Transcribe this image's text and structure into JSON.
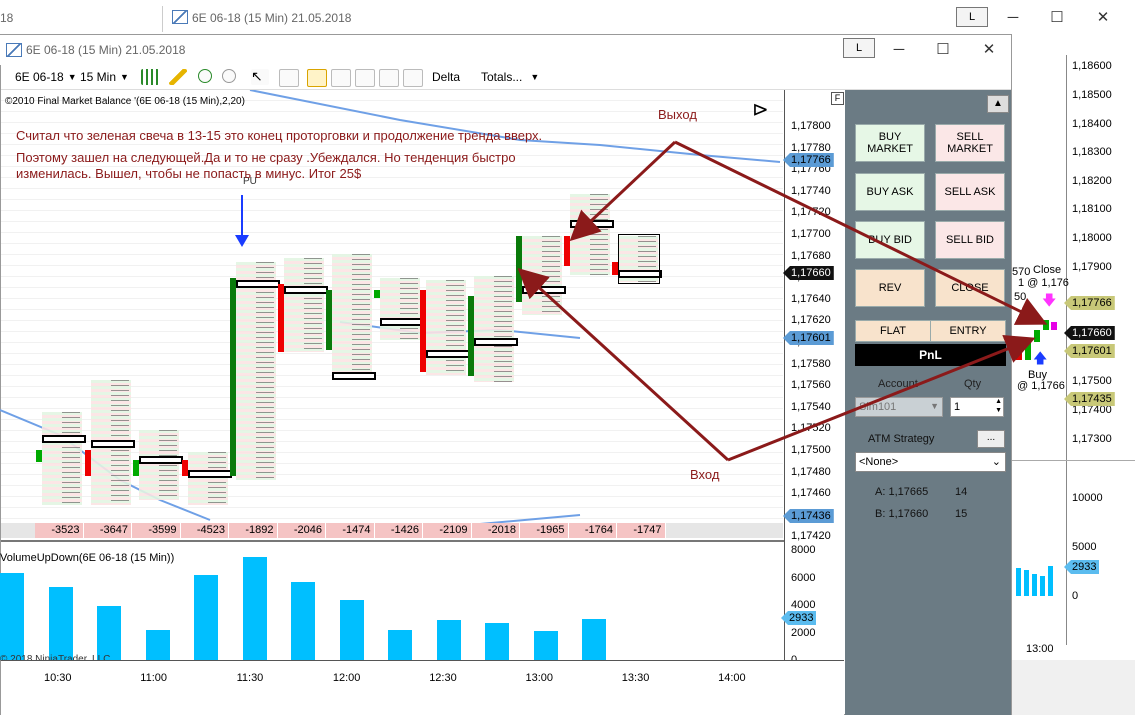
{
  "back_window": {
    "left_title_fragment": "18",
    "title": "6E 06-18 (15 Min)  21.05.2018",
    "l_button": "L",
    "minimize": "─",
    "maximize": "☐",
    "close": "✕",
    "price_axis": [
      "1,18600",
      "1,18500",
      "1,18400",
      "1,18300",
      "1,18200",
      "1,18100",
      "1,18000",
      "1,17900",
      "1,17500",
      "1,17400",
      "1,17300"
    ],
    "price_tags": [
      {
        "label": "1,17766",
        "color": "#c8c878"
      },
      {
        "label": "1,17660",
        "color": "#111111",
        "text_color": "#ffffff"
      },
      {
        "label": "1,17601",
        "color": "#c8c878"
      },
      {
        "label": "1,17435",
        "color": "#c8c878"
      }
    ],
    "volume_axis": [
      "10000",
      "5000",
      "0"
    ],
    "volume_tag": "2933",
    "time_label": "13:00",
    "chart_texts": {
      "a": "570",
      "b": "Close",
      "c": "1 @ 1,176",
      "d": "50",
      "e": "Buy",
      "f": "@ 1,1766"
    }
  },
  "front_window": {
    "title": "6E 06-18 (15 Min)  21.05.2018",
    "l_button": "L",
    "minimize": "─",
    "maximize": "☐",
    "close": "✕",
    "toolbar": {
      "instrument": "6E 06-18",
      "timeframe": "15 Min",
      "delta": "Delta",
      "totals": "Totals..."
    },
    "indicator_label": "©2010 Final Market Balance  '(6E 06-18 (15 Min),2,20)",
    "f_box": "F",
    "price_axis": [
      "1,17800",
      "1,17780",
      "1,17760",
      "1,17740",
      "1,17720",
      "1,17700",
      "1,17680",
      "1,17660",
      "1,17640",
      "1,17620",
      "1,17600",
      "1,17580",
      "1,17560",
      "1,17540",
      "1,17520",
      "1,17500",
      "1,17480",
      "1,17460",
      "1,17440",
      "1,17420"
    ],
    "price_tags": [
      {
        "label": "1,17766",
        "color": "#5b9bd5"
      },
      {
        "label": "1,17660",
        "color": "#111111",
        "text_color": "#ffffff"
      },
      {
        "label": "1,17601",
        "color": "#5b9bd5"
      },
      {
        "label": "1,17436",
        "color": "#5b9bd5"
      }
    ],
    "deltas": [
      "-3523",
      "-3647",
      "-3599",
      "-4523",
      "-1892",
      "-2046",
      "-1474",
      "-1426",
      "-2109",
      "-2018",
      "-1965",
      "-1764",
      "-1747"
    ],
    "poc_marker": "PU",
    "volume_indicator_label": "VolumeUpDown(6E 06-18 (15 Min))",
    "volume_axis": [
      "8000",
      "6000",
      "4000",
      "2000",
      "0"
    ],
    "volume_tag": "2933",
    "volume_values": [
      6300,
      5300,
      3900,
      2200,
      6200,
      7500,
      5700,
      4400,
      2200,
      2900,
      2700,
      2100,
      3000
    ],
    "copyright": "© 2018 NinjaTrader, LLC",
    "time_labels": [
      "10:30",
      "11:00",
      "11:30",
      "12:00",
      "12:30",
      "13:00",
      "13:30",
      "14:00"
    ]
  },
  "annotation": {
    "lines": [
      "Считал что зеленая свеча в 13-15 это конец проторговки и продолжение тренда вверх.",
      "Поэтому зашел на следующей.Да и то не сразу .Убеждался. Но тенденция быстро",
      "изменилась. Вышел, чтобы не попасть в минус. Итог 25$"
    ],
    "exit_label": "Выход",
    "entry_label": "Вход"
  },
  "order_panel": {
    "buy_market": "BUY MARKET",
    "sell_market": "SELL MARKET",
    "buy_ask": "BUY ASK",
    "sell_ask": "SELL ASK",
    "buy_bid": "BUY BID",
    "sell_bid": "SELL BID",
    "rev": "REV",
    "close": "CLOSE",
    "flat": "FLAT",
    "entry": "ENTRY",
    "pnl": "PnL",
    "account_label": "Account",
    "account_value": "Sim101",
    "qty_label": "Qty",
    "qty_value": "1",
    "atm_label": "ATM Strategy",
    "atm_button": "...",
    "atm_value": "<None>",
    "ask_line": "A: 1,17665",
    "ask_size": "14",
    "bid_line": "B: 1,17660",
    "bid_size": "15",
    "scroll_up": "▲",
    "colors": {
      "panel_bg": "#6b7b84",
      "pnl_bg": "#000000",
      "buy": "#e6f7e6",
      "sell": "#fbe7e7",
      "neutral": "#f8e3cc"
    }
  }
}
